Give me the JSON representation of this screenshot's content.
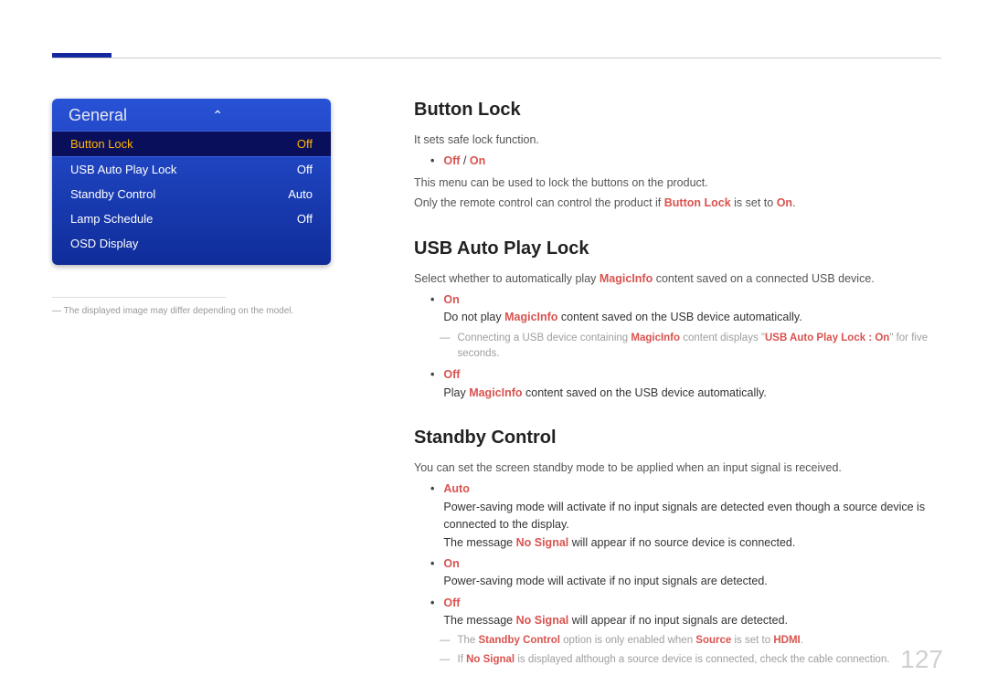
{
  "page_number": "127",
  "panel": {
    "title": "General",
    "items": [
      {
        "label": "Button Lock",
        "value": "Off",
        "selected": true
      },
      {
        "label": "USB Auto Play Lock",
        "value": "Off",
        "selected": false
      },
      {
        "label": "Standby Control",
        "value": "Auto",
        "selected": false
      },
      {
        "label": "Lamp Schedule",
        "value": "Off",
        "selected": false
      },
      {
        "label": "OSD Display",
        "value": "",
        "selected": false
      }
    ]
  },
  "footnote_dash": "―",
  "footnote": "The displayed image may differ depending on the model.",
  "sec1": {
    "heading": "Button Lock",
    "p1": "It sets safe lock function.",
    "opt_off": "Off",
    "opt_slash": " / ",
    "opt_on": "On",
    "p2": "This menu can be used to lock the buttons on the product.",
    "p3a": "Only the remote control can control the product if ",
    "p3b": "Button Lock",
    "p3c": " is set to ",
    "p3d": "On",
    "p3e": "."
  },
  "sec2": {
    "heading": "USB Auto Play Lock",
    "p1a": "Select whether to automatically play ",
    "p1b": "MagicInfo",
    "p1c": " content saved on a connected USB device.",
    "on_label": "On",
    "on_desc_a": "Do not play ",
    "on_desc_b": "MagicInfo",
    "on_desc_c": " content saved on the USB device automatically.",
    "note_a": "Connecting a USB device containing ",
    "note_b": "MagicInfo",
    "note_c": " content displays \"",
    "note_d": "USB Auto Play Lock : On",
    "note_e": "\" for five seconds.",
    "off_label": "Off",
    "off_desc_a": "Play ",
    "off_desc_b": "MagicInfo",
    "off_desc_c": " content saved on the USB device automatically."
  },
  "sec3": {
    "heading": "Standby Control",
    "p1": "You can set the screen standby mode to be applied when an input signal is received.",
    "auto_label": "Auto",
    "auto_desc": "Power-saving mode will activate if no input signals are detected even though a source device is connected to the display.",
    "auto_msg_a": "The message ",
    "auto_msg_b": "No Signal",
    "auto_msg_c": " will appear if no source device is connected.",
    "on_label": "On",
    "on_desc": "Power-saving mode will activate if no input signals are detected.",
    "off_label": "Off",
    "off_msg_a": "The message ",
    "off_msg_b": "No Signal",
    "off_msg_c": " will appear if no input signals are detected.",
    "note1_a": "The ",
    "note1_b": "Standby Control",
    "note1_c": " option is only enabled when ",
    "note1_d": "Source",
    "note1_e": " is set to ",
    "note1_f": "HDMI",
    "note1_g": ".",
    "note2_a": "If ",
    "note2_b": "No Signal",
    "note2_c": " is displayed although a source device is connected, check the cable connection."
  },
  "glyphs": {
    "bullet": "•",
    "dash": "―",
    "chevron_up": "⌃"
  }
}
